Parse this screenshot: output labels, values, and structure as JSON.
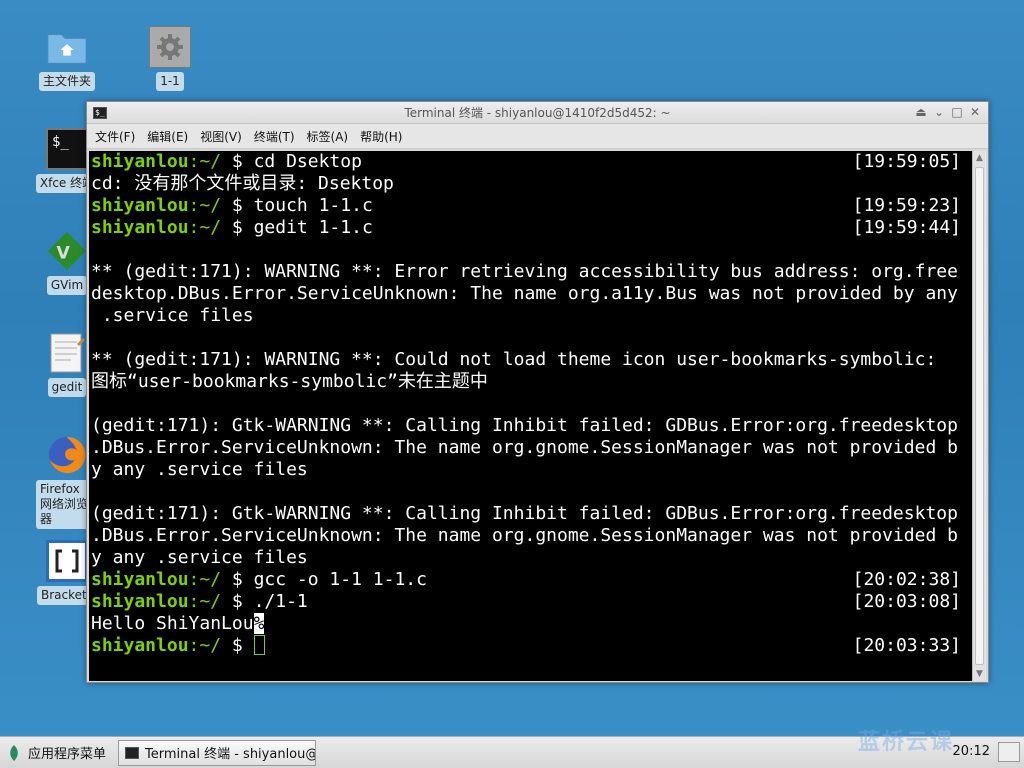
{
  "desktop": {
    "icons": [
      {
        "label": "主文件夹"
      },
      {
        "label": "1-1"
      },
      {
        "label": "Xfce 终端"
      },
      {
        "label": "GVim"
      },
      {
        "label": "gedit"
      },
      {
        "label": "Firefox 网络浏览器"
      },
      {
        "label": "Brackets"
      }
    ]
  },
  "window": {
    "title": "Terminal 终端 - shiyanlou@1410f2d5d452: ~",
    "menu": [
      "文件(F)",
      "编辑(E)",
      "视图(V)",
      "终端(T)",
      "标签(A)",
      "帮助(H)"
    ]
  },
  "terminal": {
    "user": "shiyanlou",
    "path": ":~/",
    "lines": [
      {
        "type": "prompt",
        "cmd": " $ cd Dsektop",
        "time": "[19:59:05]"
      },
      {
        "type": "out",
        "text": "cd: 没有那个文件或目录: Dsektop"
      },
      {
        "type": "prompt",
        "cmd": " $ touch 1-1.c",
        "time": "[19:59:23]"
      },
      {
        "type": "prompt",
        "cmd": " $ gedit 1-1.c",
        "time": "[19:59:44]"
      },
      {
        "type": "out",
        "text": ""
      },
      {
        "type": "out",
        "text": "** (gedit:171): WARNING **: Error retrieving accessibility bus address: org.free"
      },
      {
        "type": "out",
        "text": "desktop.DBus.Error.ServiceUnknown: The name org.a11y.Bus was not provided by any"
      },
      {
        "type": "out",
        "text": " .service files"
      },
      {
        "type": "out",
        "text": ""
      },
      {
        "type": "out",
        "text": "** (gedit:171): WARNING **: Could not load theme icon user-bookmarks-symbolic:"
      },
      {
        "type": "out",
        "text": "图标“user-bookmarks-symbolic”未在主题中"
      },
      {
        "type": "out",
        "text": ""
      },
      {
        "type": "out",
        "text": "(gedit:171): Gtk-WARNING **: Calling Inhibit failed: GDBus.Error:org.freedesktop"
      },
      {
        "type": "out",
        "text": ".DBus.Error.ServiceUnknown: The name org.gnome.SessionManager was not provided b"
      },
      {
        "type": "out",
        "text": "y any .service files"
      },
      {
        "type": "out",
        "text": ""
      },
      {
        "type": "out",
        "text": "(gedit:171): Gtk-WARNING **: Calling Inhibit failed: GDBus.Error:org.freedesktop"
      },
      {
        "type": "out",
        "text": ".DBus.Error.ServiceUnknown: The name org.gnome.SessionManager was not provided b"
      },
      {
        "type": "out",
        "text": "y any .service files"
      },
      {
        "type": "prompt",
        "cmd": " $ gcc -o 1-1 1-1.c",
        "time": "[20:02:38]"
      },
      {
        "type": "prompt",
        "cmd": " $ ./1-1",
        "time": "[20:03:08]"
      },
      {
        "type": "hello",
        "text": "Hello ShiYanLou",
        "mark": "%"
      },
      {
        "type": "current",
        "cmd": " $ ",
        "time": "[20:03:33]"
      }
    ],
    "colors": {
      "prompt": "#7fd000",
      "bg": "#000000",
      "fg": "#ffffff"
    }
  },
  "taskbar": {
    "app_menu": "应用程序菜单",
    "task_label": "Terminal 终端 - shiyanlou@…",
    "clock": "20:12",
    "watermark": "蓝桥云课"
  }
}
